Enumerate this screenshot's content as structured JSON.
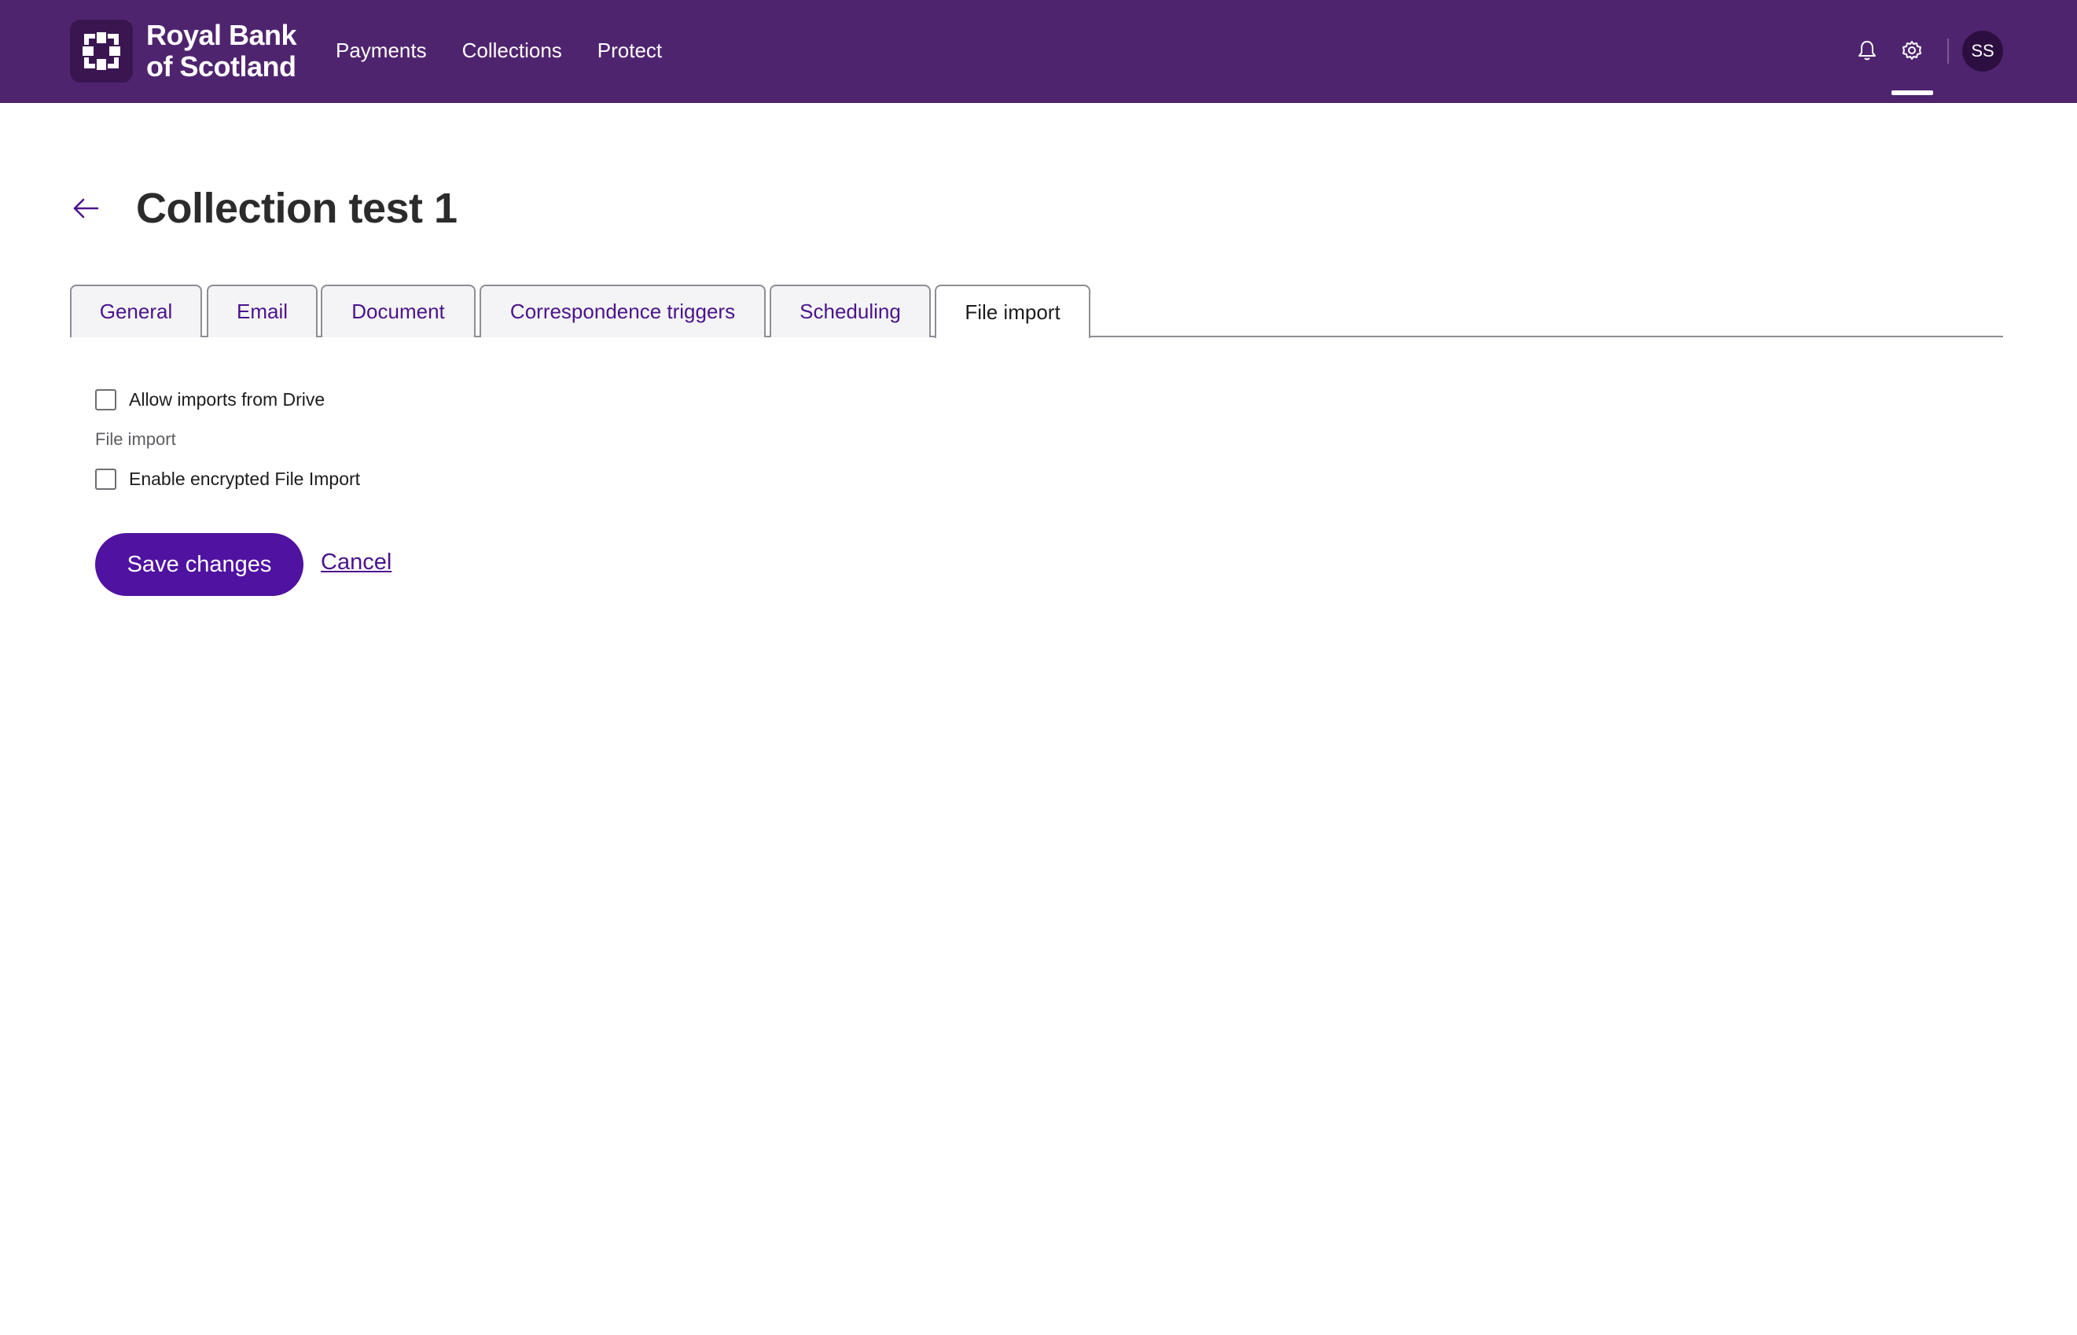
{
  "header": {
    "brand_line1": "Royal Bank",
    "brand_line2": "of Scotland",
    "nav": [
      "Payments",
      "Collections",
      "Protect"
    ],
    "avatar_initials": "SS",
    "icons": [
      "bell-icon",
      "gear-icon"
    ]
  },
  "page": {
    "title": "Collection test 1"
  },
  "tabs": [
    {
      "label": "General",
      "active": false
    },
    {
      "label": "Email",
      "active": false
    },
    {
      "label": "Document",
      "active": false
    },
    {
      "label": "Correspondence triggers",
      "active": false
    },
    {
      "label": "Scheduling",
      "active": false
    },
    {
      "label": "File import",
      "active": true
    }
  ],
  "form": {
    "allow_drive_label": "Allow imports from Drive",
    "allow_drive_checked": false,
    "section_label": "File import",
    "encrypted_label": "Enable encrypted File Import",
    "encrypted_checked": false,
    "save_label": "Save changes",
    "cancel_label": "Cancel"
  },
  "colors": {
    "header_bg": "#4f246f",
    "primary_button": "#5012a0",
    "link": "#4b138c"
  }
}
